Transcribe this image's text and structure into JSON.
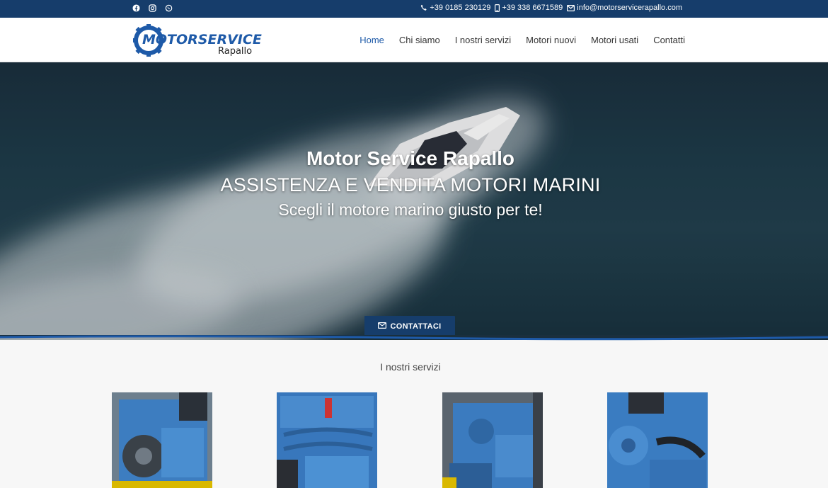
{
  "topbar": {
    "social": [
      "facebook-icon",
      "instagram-icon",
      "whatsapp-icon"
    ],
    "phone": "+39 0185 230129",
    "mobile": "+39 338 6671589",
    "email": "info@motorservicerapallo.com"
  },
  "logo": {
    "brand": "MOTORSERVICE",
    "sub": "Rapallo"
  },
  "nav": {
    "items": [
      {
        "label": "Home",
        "active": true
      },
      {
        "label": "Chi siamo"
      },
      {
        "label": "I nostri servizi"
      },
      {
        "label": "Motori nuovi"
      },
      {
        "label": "Motori usati"
      },
      {
        "label": "Contatti"
      }
    ]
  },
  "hero": {
    "title": "Motor Service Rapallo",
    "subtitle": "ASSISTENZA E VENDITA MOTORI MARINI",
    "tagline": "Scegli il motore marino giusto per te!",
    "cta": "CONTATTACI"
  },
  "services": {
    "title": "I nostri servizi"
  },
  "colors": {
    "primary": "#163d6b",
    "accent": "#1e5aa8",
    "engine": "#3a7fc4"
  }
}
